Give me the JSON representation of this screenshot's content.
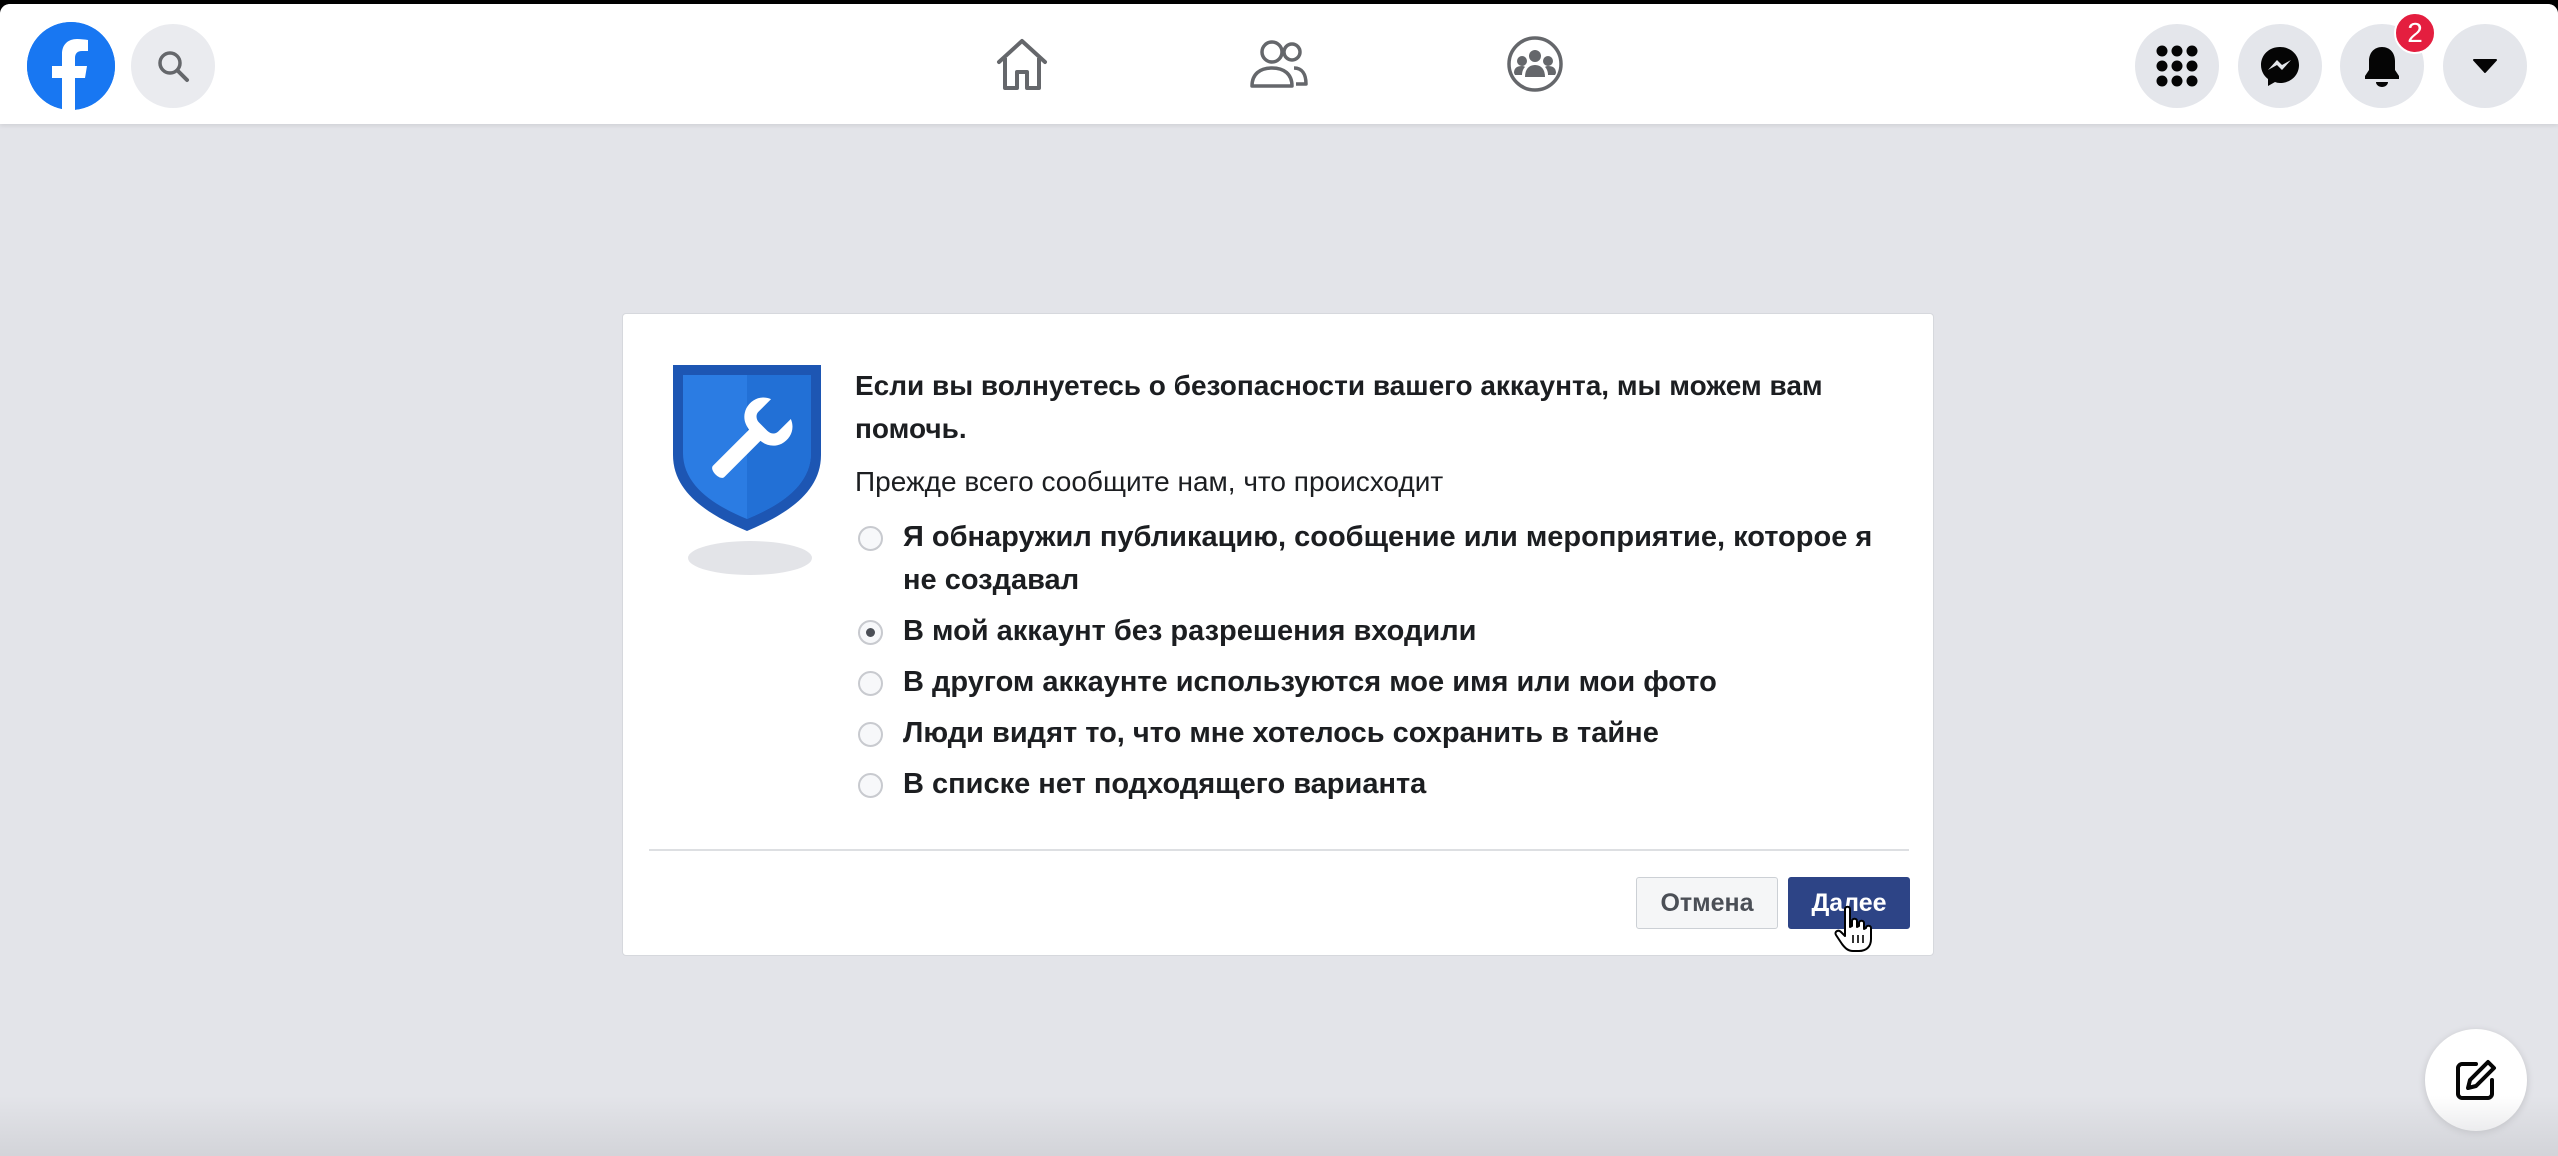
{
  "topbar": {
    "logo_icon": "facebook-logo-icon",
    "search_icon": "search-icon",
    "nav": [
      {
        "name": "home-icon"
      },
      {
        "name": "friends-icon"
      },
      {
        "name": "groups-icon"
      }
    ],
    "right": [
      {
        "name": "menu-grid-icon"
      },
      {
        "name": "messenger-icon"
      },
      {
        "name": "notifications-icon",
        "badge": "2"
      },
      {
        "name": "account-dropdown-icon"
      }
    ]
  },
  "dialog": {
    "illustration_icon": "shield-wrench-icon",
    "heading": "Если вы волнуетесь о безопасности вашего аккаунта, мы можем вам помочь.",
    "subheading": "Прежде всего сообщите нам, что происходит",
    "options": [
      {
        "label": "Я обнаружил публикацию, сообщение или мероприятие, которое я не создавал",
        "checked": false
      },
      {
        "label": "В мой аккаунт без разрешения входили",
        "checked": true
      },
      {
        "label": "В другом аккаунте используются мое имя или мои фото",
        "checked": false
      },
      {
        "label": "Люди видят то, что мне хотелось сохранить в тайне",
        "checked": false
      },
      {
        "label": "В списке нет подходящего варианта",
        "checked": false
      }
    ],
    "cancel_label": "Отмена",
    "next_label": "Далее"
  },
  "compose_icon": "compose-icon",
  "colors": {
    "brand": "#1877f2",
    "primary_button": "#2d4486",
    "badge": "#e41e3f",
    "background": "#e3e4e9"
  }
}
